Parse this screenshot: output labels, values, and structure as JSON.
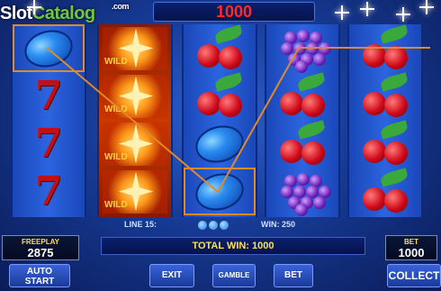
{
  "header": {
    "total_win_display": "1000"
  },
  "watermark": {
    "part1": "Slot",
    "part2": "Catalog",
    "suffix": ".com"
  },
  "status": {
    "line_label": "LINE 15:",
    "win_label": "WIN: 250"
  },
  "total_win": "TOTAL WIN: 1000",
  "freeplay": {
    "label": "FREEPLAY",
    "value": "2875"
  },
  "bet_panel": {
    "label": "BET",
    "value": "1000"
  },
  "buttons": {
    "auto_start_line1": "AUTO",
    "auto_start_line2": "START",
    "exit": "EXIT",
    "gamble": "GAMBLE",
    "bet": "BET",
    "collect": "COLLECT"
  },
  "reels": [
    [
      "plum",
      "seven",
      "seven",
      "seven"
    ],
    [
      "wild",
      "wild",
      "wild",
      "wild"
    ],
    [
      "cherry",
      "cherry",
      "plum",
      "plum"
    ],
    [
      "grape",
      "cherry",
      "cherry",
      "grape"
    ],
    [
      "cherry",
      "cherry",
      "cherry",
      "cherry"
    ]
  ],
  "wild_text": "WILD",
  "colors": {
    "accent": "#ffe14a",
    "win_red": "#ff2a2a",
    "payline": "#e08a2a"
  }
}
